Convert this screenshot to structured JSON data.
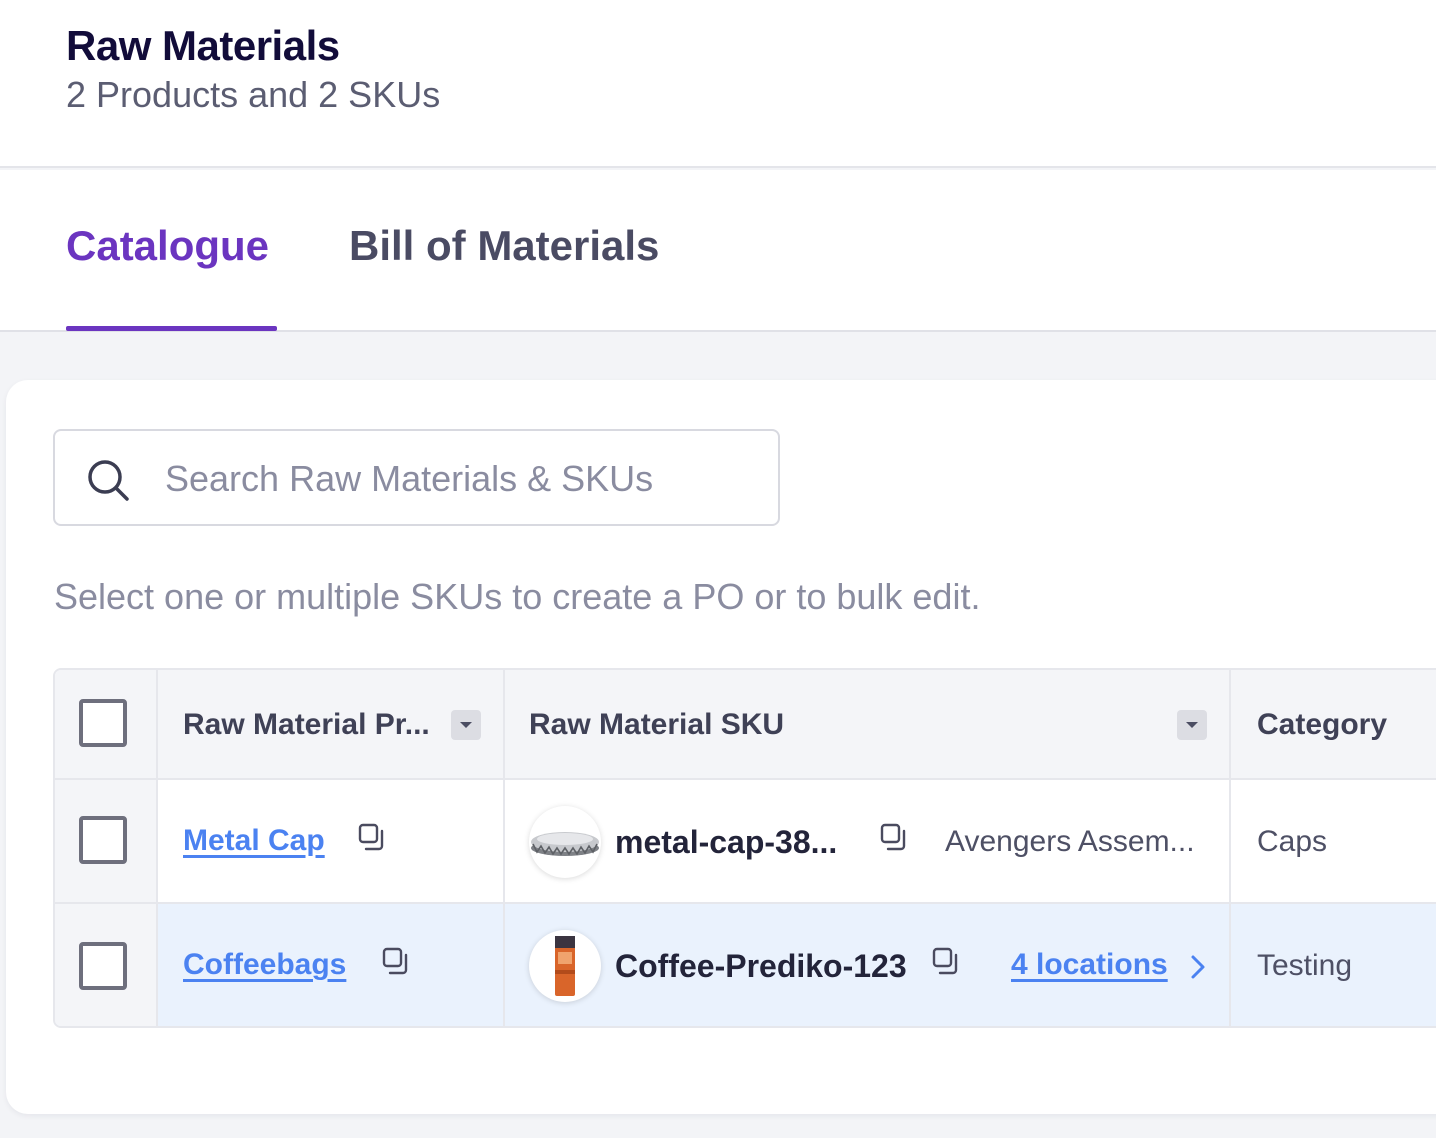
{
  "header": {
    "title": "Raw Materials",
    "subtitle": "2 Products and 2 SKUs"
  },
  "tabs": [
    {
      "label": "Catalogue",
      "active": true
    },
    {
      "label": "Bill of Materials",
      "active": false
    }
  ],
  "search": {
    "placeholder": "Search Raw Materials & SKUs",
    "value": ""
  },
  "helper_text": "Select one or multiple SKUs to create a PO or to bulk edit.",
  "table": {
    "columns": [
      "Raw Material Pr...",
      "Raw Material SKU",
      "Category"
    ],
    "rows": [
      {
        "product": "Metal Cap",
        "sku": "metal-cap-38...",
        "location": "Avengers Assem...",
        "location_is_link": false,
        "category": "Caps",
        "thumb_icon": "metal-cap-image",
        "selected": false
      },
      {
        "product": "Coffeebags",
        "sku": "Coffee-Prediko-123",
        "location": "4 locations",
        "location_is_link": true,
        "category": "Testing",
        "thumb_icon": "coffee-bag-image",
        "selected": false
      }
    ]
  },
  "colors": {
    "accent": "#6b35c0",
    "link": "#4b82f1",
    "title": "#120c3a",
    "row_highlight": "#eaf2fd"
  }
}
